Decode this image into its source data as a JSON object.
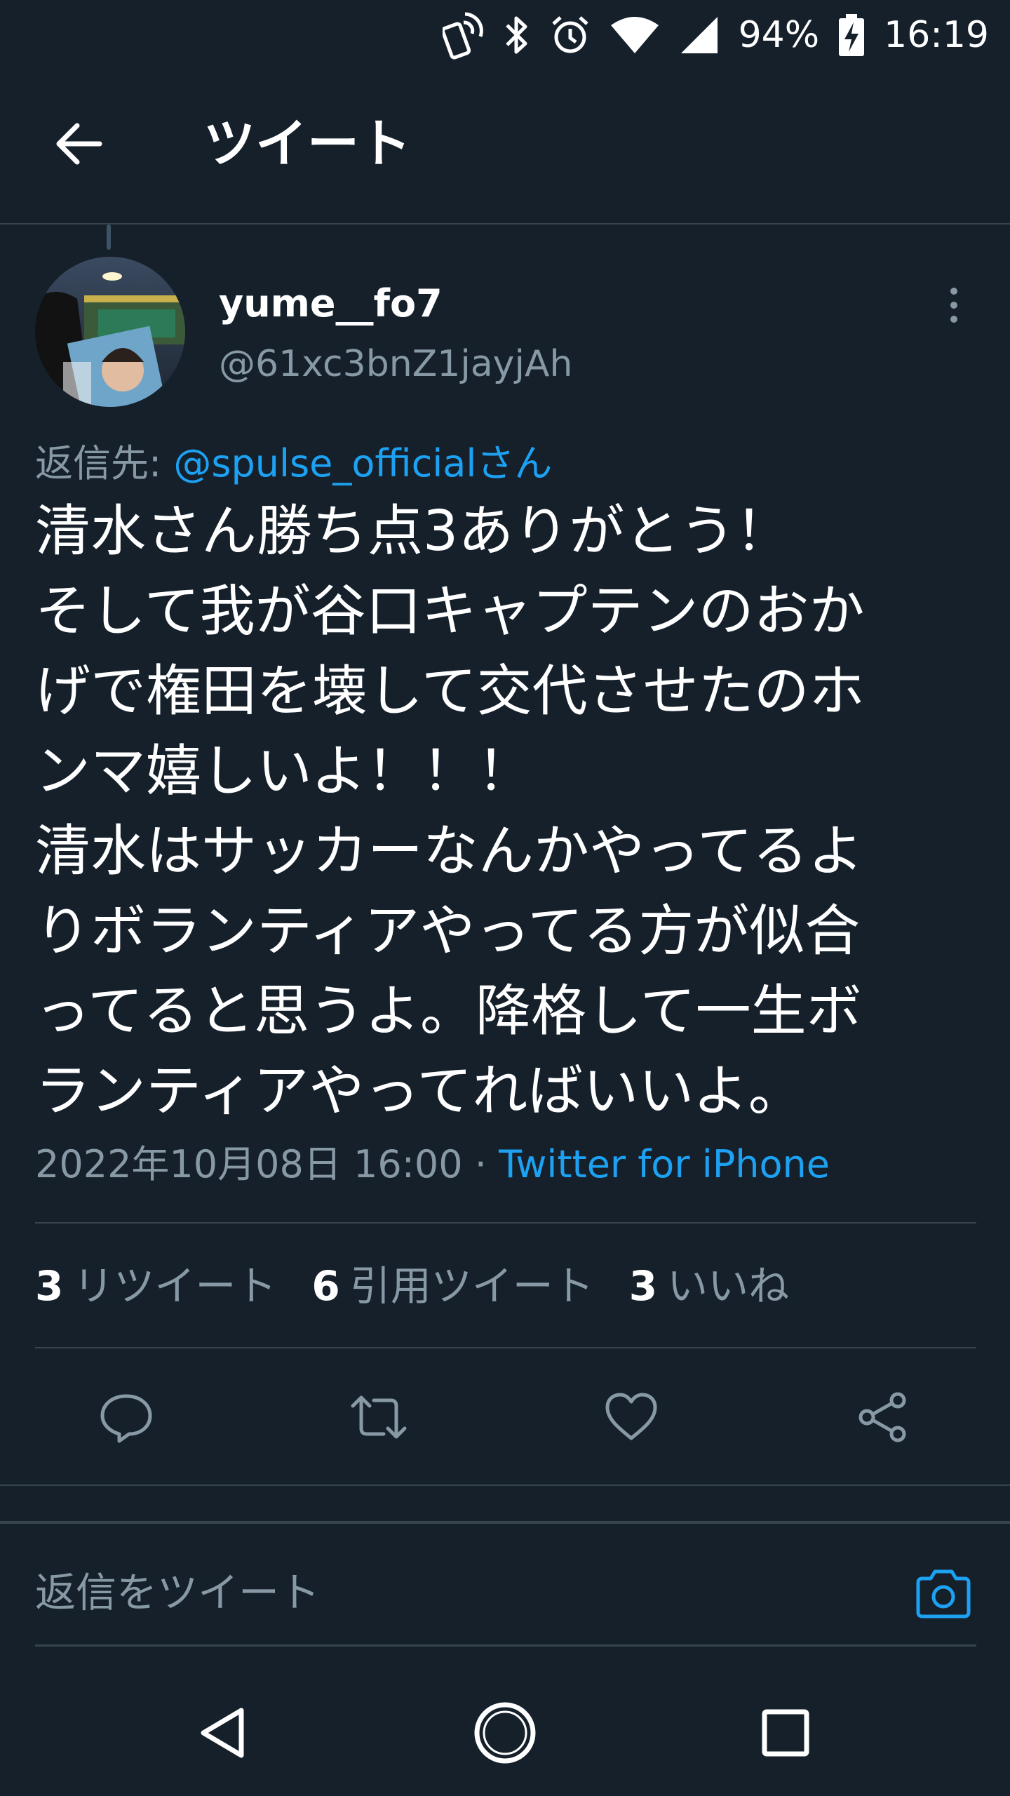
{
  "status_bar": {
    "battery": "94%",
    "time": "16:19",
    "icons": [
      "nfc-icon",
      "bluetooth-icon",
      "alarm-icon",
      "wifi-icon",
      "signal-icon",
      "battery-charging-icon"
    ]
  },
  "header": {
    "title": "ツイート",
    "back_icon": "arrow-left-icon"
  },
  "tweet": {
    "author": {
      "display_name": "yume__fo7",
      "handle": "@61xc3bnZ1jayjAh"
    },
    "reply_to": {
      "prefix": "返信先: ",
      "mention": "@spulse_officialさん"
    },
    "text_lines": [
      "清水さん勝ち点3ありがとう！",
      "そして我が谷口キャプテンのおか",
      "げで権田を壊して交代させたのホ",
      "ンマ嬉しいよ！！！",
      "清水はサッカーなんかやってるよ",
      "りボランティアやってる方が似合",
      "ってると思うよ。降格して一生ボ",
      "ランティアやってればいいよ。"
    ],
    "timestamp": "2022年10月08日 16:00 · ",
    "source": "Twitter for iPhone",
    "stats": {
      "retweets_count": "3",
      "retweets_label": "リツイート",
      "quotes_count": "6",
      "quotes_label": "引用ツイート",
      "likes_count": "3",
      "likes_label": "いいね"
    },
    "actions": [
      "reply-icon",
      "retweet-icon",
      "like-icon",
      "share-icon"
    ]
  },
  "reply_composer": {
    "placeholder": "返信をツイート",
    "camera_icon": "camera-icon"
  },
  "nav_bar": [
    "back-triangle-icon",
    "home-circle-icon",
    "recents-square-icon"
  ],
  "colors": {
    "background": "#15202b",
    "accent": "#1da1f2",
    "secondary_text": "#8899a6",
    "divider": "#38444d"
  }
}
